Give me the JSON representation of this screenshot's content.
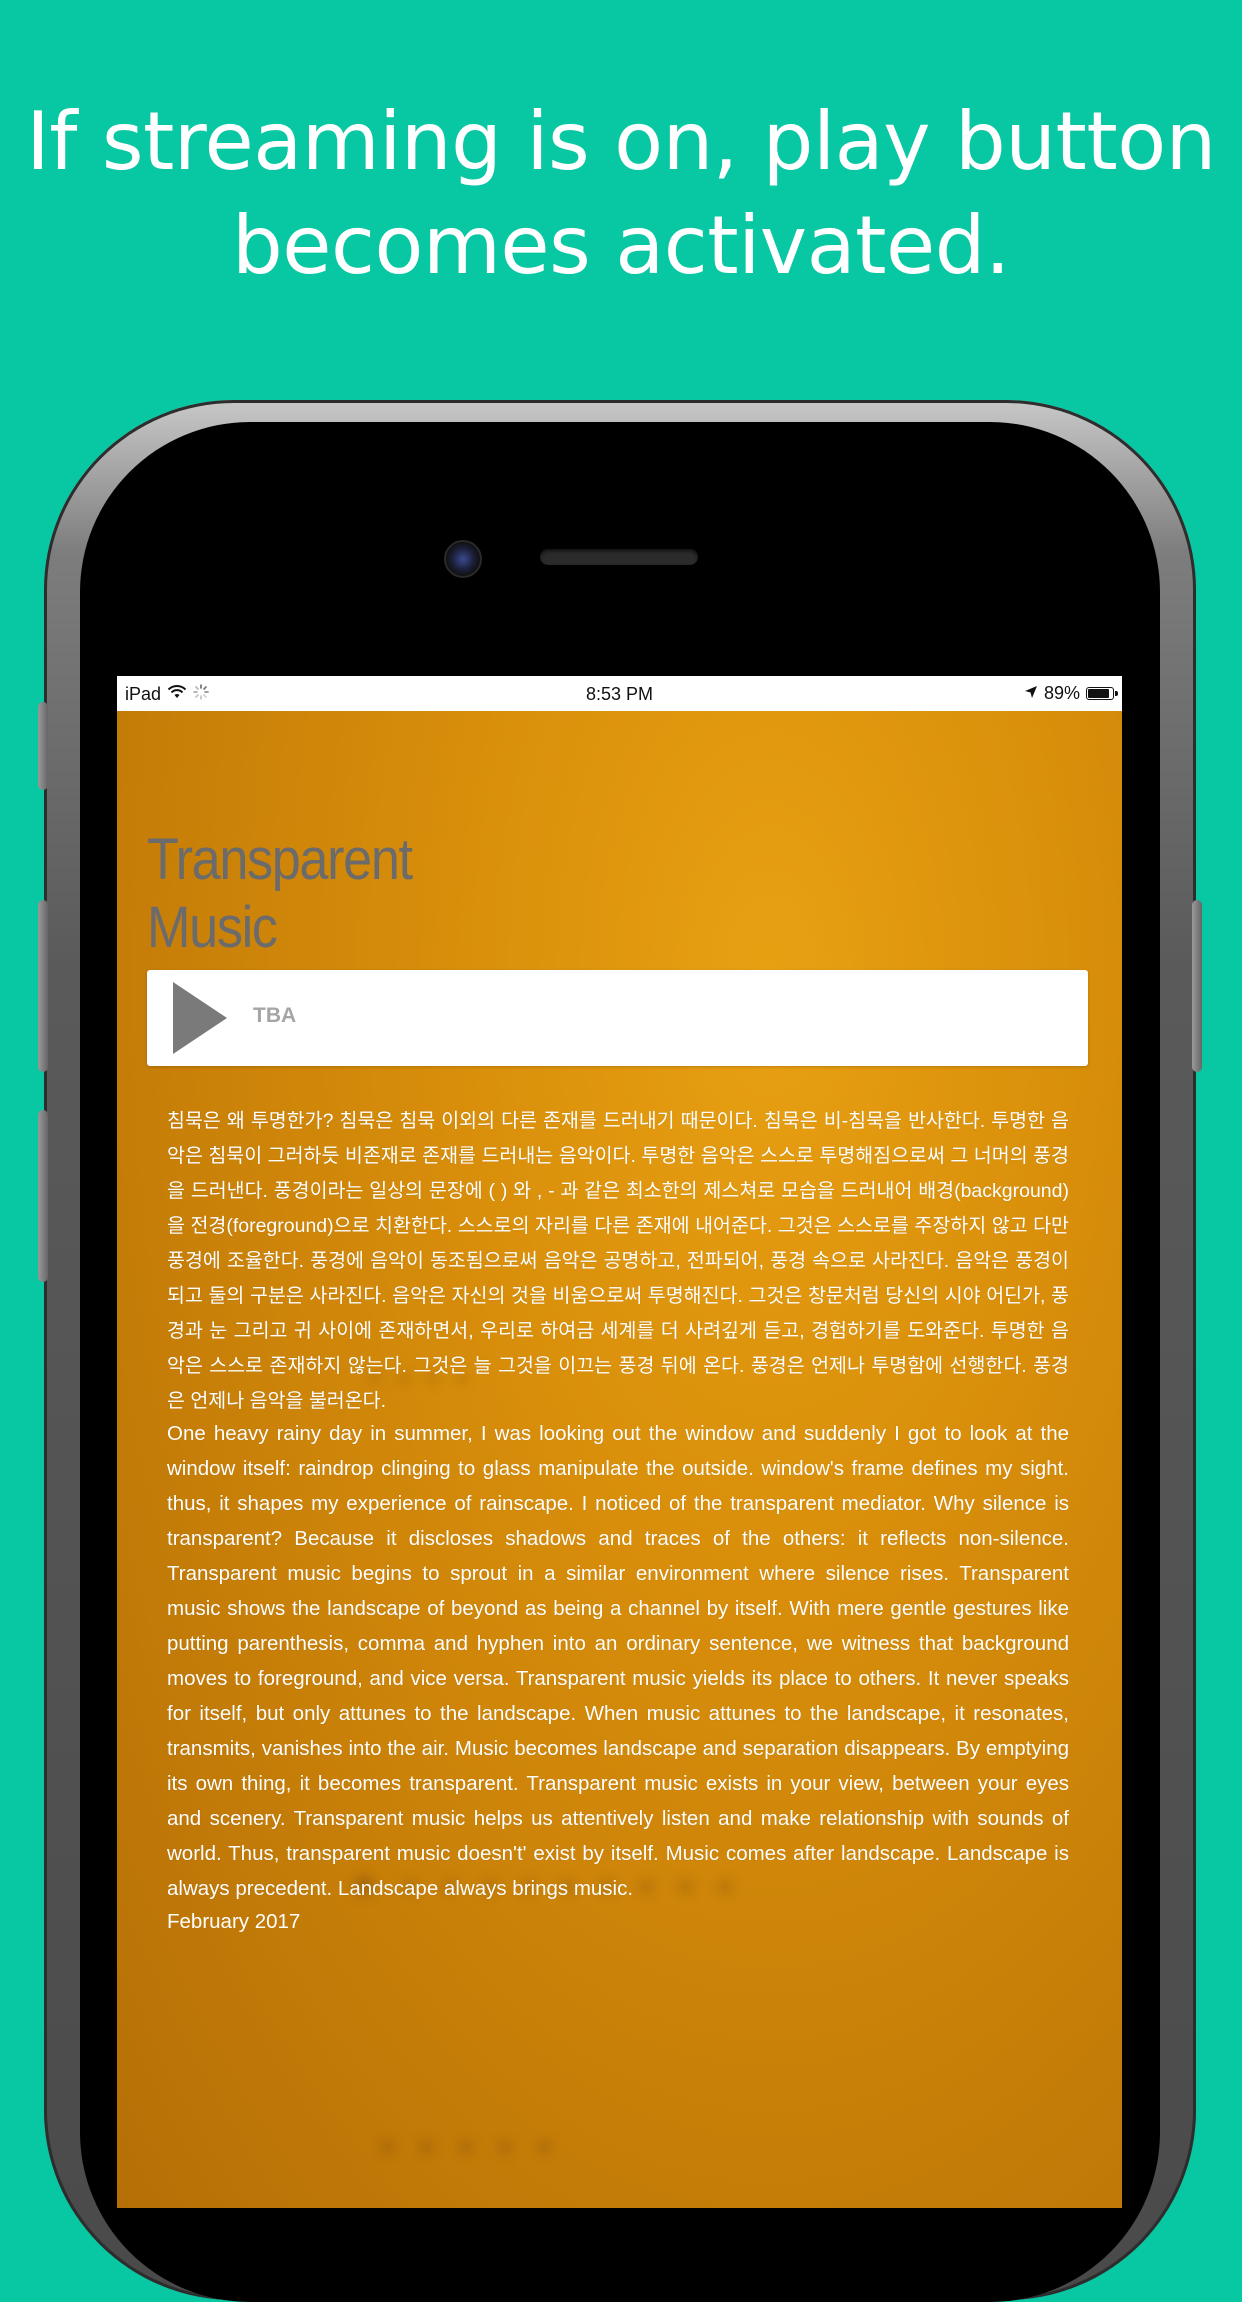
{
  "headline": {
    "line1": "If streaming is on, play button",
    "line2": "becomes activated."
  },
  "status_bar": {
    "device": "iPad",
    "time": "8:53 PM",
    "battery": "89%",
    "battery_level": 0.89
  },
  "app": {
    "title_line1": "Transparent",
    "title_line2": "Music"
  },
  "player": {
    "track_label": "TBA"
  },
  "content": {
    "korean": "침묵은 왜 투명한가? 침묵은 침묵 이외의 다른 존재를 드러내기 때문이다. 침묵은 비-침묵을 반사한다. 투명한 음악은 침묵이 그러하듯 비존재로 존재를 드러내는 음악이다. 투명한 음악은 스스로 투명해짐으로써 그 너머의 풍경을 드러낸다. 풍경이라는 일상의 문장에 ( ) 와 , - 과 같은 최소한의 제스쳐로 모습을 드러내어 배경(background)을 전경(foreground)으로 치환한다. 스스로의 자리를 다른 존재에 내어준다. 그것은 스스로를 주장하지 않고 다만 풍경에 조율한다. 풍경에 음악이 동조됨으로써 음악은 공명하고, 전파되어, 풍경 속으로 사라진다. 음악은 풍경이 되고 둘의 구분은 사라진다. 음악은 자신의 것을 비움으로써 투명해진다. 그것은 창문처럼 당신의 시야 어딘가, 풍경과 눈 그리고 귀 사이에 존재하면서, 우리로 하여금 세계를 더 사려깊게 듣고, 경험하기를 도와준다. 투명한 음악은 스스로 존재하지 않는다. 그것은 늘 그것을 이끄는 풍경 뒤에 온다. 풍경은 언제나 투명함에 선행한다. 풍경은 언제나 음악을 불러온다.",
    "english": "One heavy rainy day in summer, I was looking out the window and suddenly I got to look at the window itself: raindrop clinging to glass manipulate the outside. window's frame defines my sight. thus, it shapes my experience of rainscape. I noticed of the transparent mediator. Why silence is transparent? Because it discloses shadows and traces of the others: it reflects non-silence. Transparent music begins to sprout in a similar environment where silence rises.        Transparent music shows the landscape of beyond as being a channel by itself. With mere gentle gestures like putting parenthesis, comma and hyphen into an ordinary sentence, we  witness that background moves to foreground, and vice versa. Transparent music yields its place to others. It never speaks for itself, but only attunes to the landscape. When music attunes to the landscape, it resonates, transmits, vanishes into the air. Music becomes landscape and separation disappears. By emptying its own thing, it becomes transparent. Transparent music exists in your view, between your eyes and scenery. Transparent music helps us attentively listen and make relationship with sounds of world.   Thus, transparent music doesn't' exist by itself. Music comes after landscape. Landscape is always precedent. Landscape always brings music.",
    "date": "February 2017"
  },
  "colors": {
    "background": "#08c7a3",
    "screen_bg": "#d88e0a",
    "title_gray": "#6b6b6b",
    "play_gray": "#7a7a7a"
  },
  "icons": {
    "wifi": "wifi-icon",
    "activity": "activity-spinner-icon",
    "location": "location-arrow-icon",
    "battery": "battery-icon",
    "play": "play-icon"
  }
}
